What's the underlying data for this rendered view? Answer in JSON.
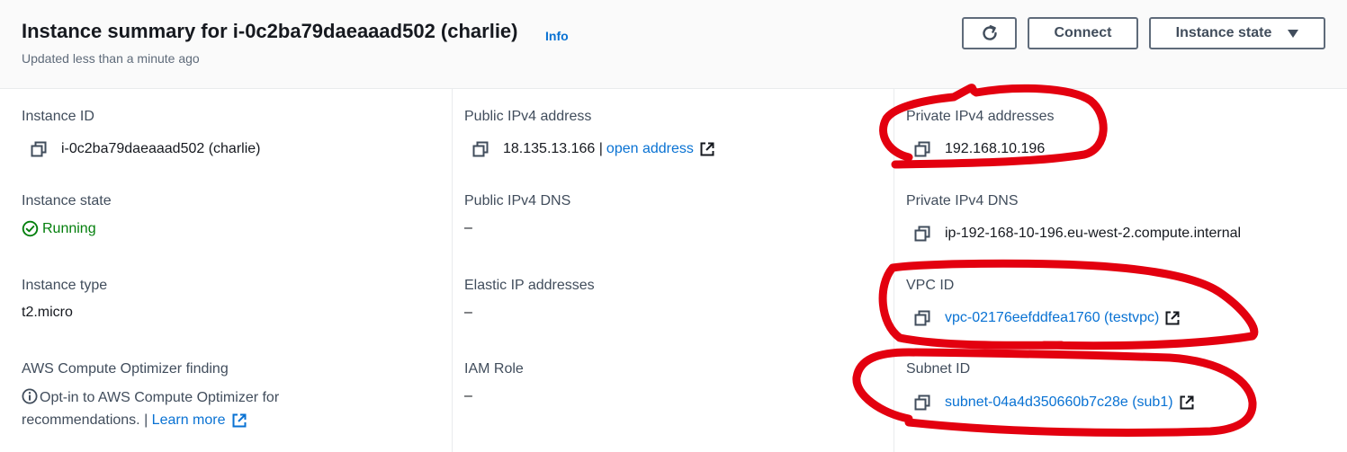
{
  "header": {
    "title": "Instance summary for i-0c2ba79daeaaad502 (charlie)",
    "info_link": "Info",
    "subtitle": "Updated less than a minute ago",
    "refresh_icon": "refresh-icon",
    "connect_label": "Connect",
    "instance_state_label": "Instance state"
  },
  "col1": {
    "instance_id": {
      "label": "Instance ID",
      "value": "i-0c2ba79daeaaad502 (charlie)"
    },
    "instance_state": {
      "label": "Instance state",
      "value": "Running"
    },
    "instance_type": {
      "label": "Instance type",
      "value": "t2.micro"
    },
    "optimizer": {
      "label": "AWS Compute Optimizer finding",
      "line1": "Opt-in to AWS Compute Optimizer for",
      "line2": "recommendations. |",
      "learn_more": "Learn more"
    }
  },
  "col2": {
    "public_ipv4": {
      "label": "Public IPv4 address",
      "value": "18.135.13.166 |",
      "link": "open address"
    },
    "public_dns": {
      "label": "Public IPv4 DNS",
      "value": "–"
    },
    "elastic_ip": {
      "label": "Elastic IP addresses",
      "value": "–"
    },
    "iam_role": {
      "label": "IAM Role",
      "value": "–"
    }
  },
  "col3": {
    "private_ipv4": {
      "label": "Private IPv4 addresses",
      "value": "192.168.10.196"
    },
    "private_dns": {
      "label": "Private IPv4 DNS",
      "value": "ip-192-168-10-196.eu-west-2.compute.internal"
    },
    "vpc_id": {
      "label": "VPC ID",
      "value": "vpc-02176eefddfea1760 (testvpc)"
    },
    "subnet_id": {
      "label": "Subnet ID",
      "value": "subnet-04a4d350660b7c28e (sub1)"
    }
  },
  "colors": {
    "link": "#0972d3",
    "running": "#037f0c",
    "annotation": "#e3000f"
  }
}
